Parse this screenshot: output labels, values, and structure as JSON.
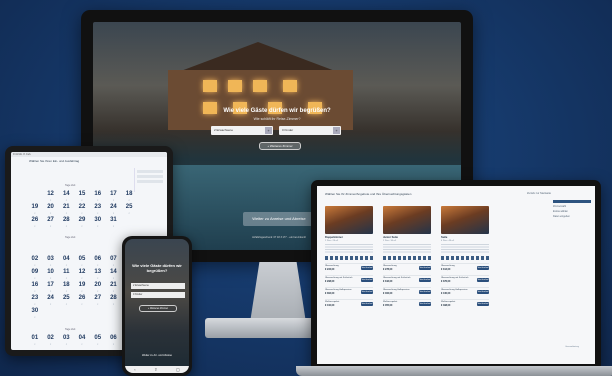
{
  "monitor": {
    "hero_title": "Wie viele Gäste dürfen wir begrüßen?",
    "hero_subtitle": "Wie schläft ihr Reise-Zimmer?",
    "adults_field": "2 Erwachsene",
    "children_field": "0 Kinder",
    "stepper_minus": "−",
    "stepper_plus": "+",
    "add_room_label": "+ Weiteres Zimmer",
    "continue_label": "Weiter zu Anreise und Abreise",
    "footer_note": "Anfahrtsgeschenk: 07 18 3 177 ...ein bei Ankunft"
  },
  "tablet": {
    "status": "9:41  Mo. 8. Feb.",
    "title": "Wählen Sie Ihren Ein- und Ausfahrtag",
    "months": [
      {
        "label": "Tage Zeit",
        "days": [
          "",
          "12",
          "14",
          "15",
          "16",
          "17",
          "18",
          "19",
          "20",
          "21",
          "22",
          "23",
          "24",
          "25",
          "26",
          "27",
          "28",
          "29",
          "30",
          "31",
          ""
        ]
      },
      {
        "label": "Tage Zeit",
        "days": [
          "",
          "",
          "",
          "",
          "",
          "",
          "01",
          "02",
          "03",
          "04",
          "05",
          "06",
          "07",
          "08",
          "09",
          "10",
          "11",
          "12",
          "13",
          "14",
          "15",
          "16",
          "17",
          "18",
          "19",
          "20",
          "21",
          "22",
          "23",
          "24",
          "25",
          "26",
          "27",
          "28",
          "29",
          "30",
          "",
          "",
          "",
          "",
          "",
          ""
        ]
      },
      {
        "label": "Tage Zeit",
        "days": [
          "01",
          "02",
          "03",
          "04",
          "05",
          "06"
        ]
      }
    ]
  },
  "phone": {
    "title": "Wie viele Gäste dürfen wir begrüßen?",
    "adults_field": "2 Erwachsene",
    "children_field": "0 Kinder",
    "add_room_label": "+ Weiteres Zimmer",
    "continue_label": "Weiter zu Arr. und Abreise",
    "nav_back": "‹",
    "nav_share": "⇪",
    "nav_tabs": "▢"
  },
  "laptop": {
    "title": "Wählen Sie Ihr Zimmer/Angebote und Ihre Übernachtungsgästen",
    "link": "Zurück zur Startseite",
    "sidebar_items": [
      "Zimmerwahl",
      "Extras wählen",
      "Daten eingeben"
    ],
    "sidebar_footer": "Gesamtbetrag",
    "rooms": [
      {
        "name": "Doppelzimmer",
        "sub": "2 Pers. 28 m²",
        "offers": [
          {
            "name": "Übernachtung",
            "price": "€ 234,00",
            "button": "Jetzt buchen"
          },
          {
            "name": "Übernachtung mit Frühstück",
            "price": "€ 298,00",
            "button": "Jetzt buchen"
          },
          {
            "name": "Übernachtung Halbpension",
            "price": "€ 362,00",
            "button": "Jetzt buchen"
          },
          {
            "name": "Wellnesspaket",
            "price": "€ 410,00",
            "button": "Jetzt buchen"
          }
        ]
      },
      {
        "name": "Junior Suite",
        "sub": "2 Pers. 36 m²",
        "offers": [
          {
            "name": "Übernachtung",
            "price": "€ 278,00",
            "button": "Jetzt buchen"
          },
          {
            "name": "Übernachtung mit Frühstück",
            "price": "€ 342,00",
            "button": "Jetzt buchen"
          },
          {
            "name": "Übernachtung Halbpension",
            "price": "€ 406,00",
            "button": "Jetzt buchen"
          },
          {
            "name": "Wellnesspaket",
            "price": "€ 455,00",
            "button": "Jetzt buchen"
          }
        ]
      },
      {
        "name": "Suite",
        "sub": "4 Pers. 48 m²",
        "offers": [
          {
            "name": "Übernachtung",
            "price": "€ 312,00",
            "button": "Jetzt buchen"
          },
          {
            "name": "Übernachtung mit Frühstück",
            "price": "€ 376,00",
            "button": "Jetzt buchen"
          },
          {
            "name": "Übernachtung Halbpension",
            "price": "€ 440,00",
            "button": "Jetzt buchen"
          },
          {
            "name": "Wellnesspaket",
            "price": "€ 498,00",
            "button": "Jetzt buchen"
          }
        ]
      }
    ]
  },
  "colors": {
    "background": "#163a6c",
    "accent": "#2b4f7c",
    "window_glow": "#f0b657"
  }
}
